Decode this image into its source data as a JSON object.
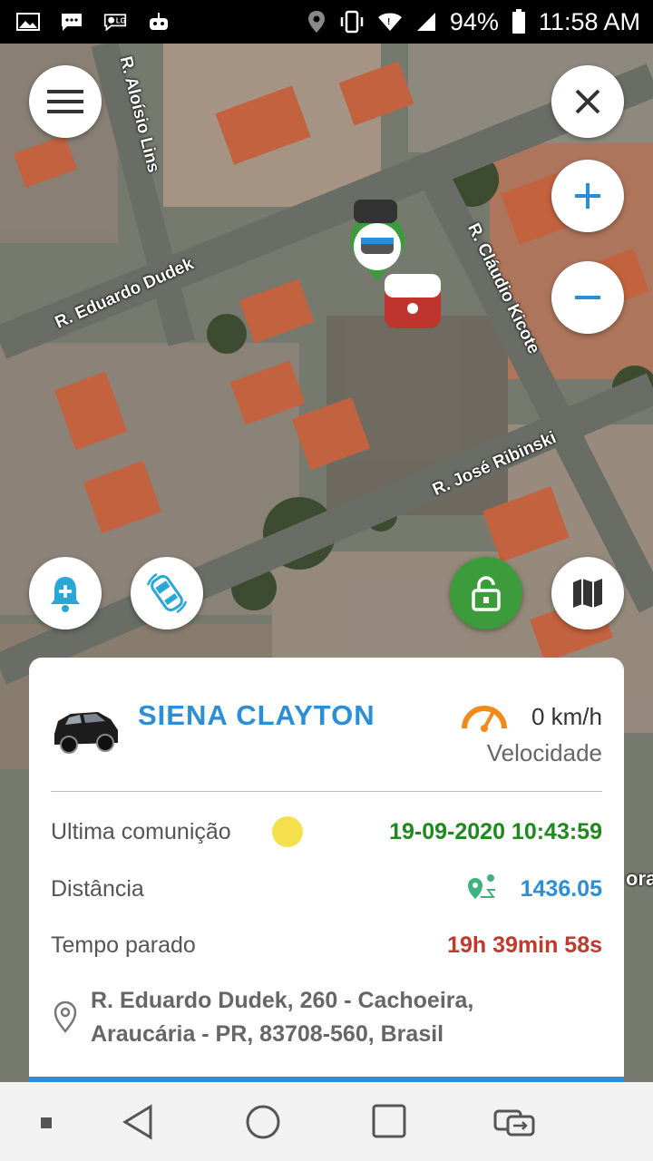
{
  "status_bar": {
    "battery": "94%",
    "time": "11:58 AM",
    "left_icons": [
      "image-icon",
      "sms-icon",
      "lg-icon",
      "robot-icon"
    ],
    "right_icons": [
      "location-icon",
      "vibrate-icon",
      "wifi-icon",
      "signal-icon",
      "battery-icon"
    ]
  },
  "map": {
    "streets": {
      "s1": "R. Aloísio Lins",
      "s2": "R. Eduardo Dudek",
      "s3": "R. Cláudio Kicote",
      "s4": "R. José Ribinski"
    },
    "edge_label": "ora"
  },
  "vehicle": {
    "name": "SIENA  CLAYTON",
    "speed": "0 km/h",
    "speed_label": "Velocidade"
  },
  "details": {
    "last_comm_label": "Ultima comunição",
    "last_comm_value": "19-09-2020 10:43:59",
    "distance_label": "Distância",
    "distance_value": "1436.05",
    "stopped_label": "Tempo parado",
    "stopped_value": "19h 39min 58s",
    "address_line1": "R. Eduardo Dudek, 260 - Cachoeira,",
    "address_line2": "Araucária - PR, 83708-560, Brasil"
  },
  "colors": {
    "accent": "#2a8fd8",
    "green_date": "#1e8a1e",
    "red_time": "#c0392b",
    "status_dot": "#f4e04d",
    "lock_green": "#3c9c3c",
    "speed_orange": "#f28a1a"
  }
}
